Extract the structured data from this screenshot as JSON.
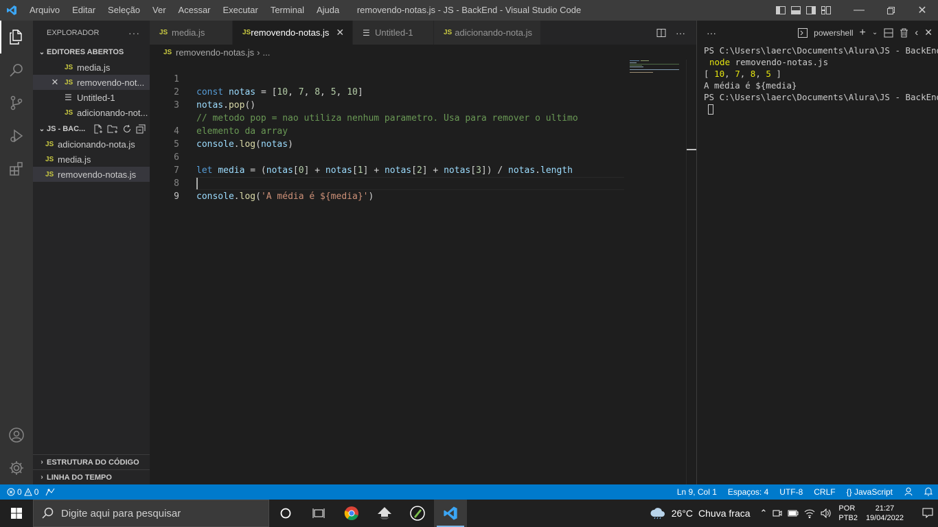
{
  "titlebar": {
    "menu": [
      "Arquivo",
      "Editar",
      "Seleção",
      "Ver",
      "Acessar",
      "Executar",
      "Terminal",
      "Ajuda"
    ],
    "title": "removendo-notas.js - JS - BackEnd - Visual Studio Code"
  },
  "sidebar": {
    "header": "EXPLORADOR",
    "open_editors_title": "EDITORES ABERTOS",
    "open_editors": [
      {
        "name": "media.js",
        "type": "js"
      },
      {
        "name": "removendo-not...",
        "type": "js"
      },
      {
        "name": "Untitled-1",
        "type": "text"
      },
      {
        "name": "adicionando-not...",
        "type": "js"
      }
    ],
    "folder_title": "JS - BAC...",
    "files": [
      "adicionando-nota.js",
      "media.js",
      "removendo-notas.js"
    ],
    "outline_title": "ESTRUTURA DO CÓDIGO",
    "timeline_title": "LINHA DO TEMPO"
  },
  "tabs": [
    {
      "label": "media.js",
      "badge": "JS"
    },
    {
      "label": "removendo-notas.js",
      "badge": "JS"
    },
    {
      "label": "Untitled-1",
      "badge": ""
    },
    {
      "label": "adicionando-nota.js",
      "badge": "JS"
    }
  ],
  "breadcrumb": {
    "file": "removendo-notas.js",
    "rest": "..."
  },
  "editor": {
    "line_numbers": [
      "1",
      "2",
      "3",
      "",
      "4",
      "5",
      "6",
      "7",
      "8",
      "9"
    ],
    "lines": [
      "const notas = [10, 7, 8, 5, 10]",
      "notas.pop()",
      "// metodo pop = nao utiliza nenhum parametro. Usa para remover o ultimo",
      "elemento da array",
      "console.log(notas)",
      "",
      "let media = (notas[0] + notas[1] + notas[2] + notas[3]) / notas.length",
      "",
      "console.log('A média é ${media}')",
      ""
    ]
  },
  "terminal": {
    "shell": "powershell",
    "prompt1": "PS C:\\Users\\laerc\\Documents\\Alura\\JS - BackEnd>",
    "cmd_name": "node",
    "cmd_arg": " removendo-notas.js",
    "out_open": "[ ",
    "out_nums": [
      "10",
      "7",
      "8",
      "5"
    ],
    "out_close": " ]",
    "out2": "A média é ${media}",
    "prompt2": "PS C:\\Users\\laerc\\Documents\\Alura\\JS - BackEnd>"
  },
  "statusbar": {
    "errors": "0",
    "warnings": "0",
    "position": "Ln 9, Col 1",
    "spaces": "Espaços: 4",
    "encoding": "UTF-8",
    "eol": "CRLF",
    "language": "JavaScript"
  },
  "taskbar": {
    "search_placeholder": "Digite aqui para pesquisar",
    "temperature": "26°C",
    "weather": "Chuva fraca",
    "lang1": "POR",
    "lang2": "PTB2",
    "time": "21:27",
    "date": "19/04/2022"
  },
  "colors": {
    "accent": "#007acc",
    "js_badge": "#cbcb41",
    "keyword": "#569cd6",
    "string": "#ce9178",
    "comment": "#6a9955"
  }
}
